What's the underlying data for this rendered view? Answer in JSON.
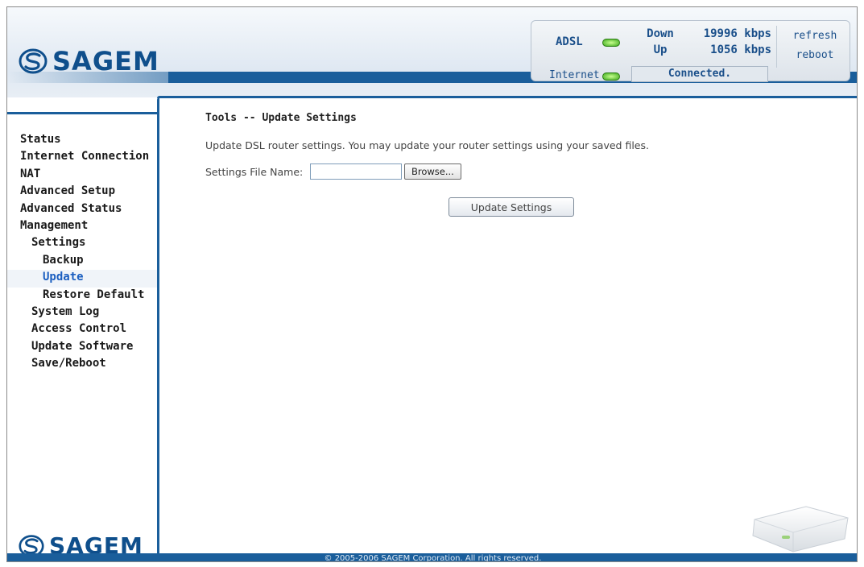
{
  "brand": {
    "name": "SAGEM"
  },
  "status_panel": {
    "adsl_label": "ADSL",
    "internet_label": "Internet",
    "down_label": "Down",
    "down_value": "19996 kbps",
    "up_label": "Up",
    "up_value": "1056 kbps",
    "connection_status": "Connected.",
    "refresh_label": "refresh",
    "reboot_label": "reboot",
    "led_color": "#3caa1c"
  },
  "sidebar": {
    "items": [
      {
        "label": "Status",
        "level": 1,
        "active": false
      },
      {
        "label": "Internet Connection",
        "level": 1,
        "active": false
      },
      {
        "label": "NAT",
        "level": 1,
        "active": false
      },
      {
        "label": "Advanced Setup",
        "level": 1,
        "active": false
      },
      {
        "label": "Advanced Status",
        "level": 1,
        "active": false
      },
      {
        "label": "Management",
        "level": 1,
        "active": false
      },
      {
        "label": "Settings",
        "level": 2,
        "active": false
      },
      {
        "label": "Backup",
        "level": 3,
        "active": false
      },
      {
        "label": "Update",
        "level": 3,
        "active": true
      },
      {
        "label": "Restore Default",
        "level": 3,
        "active": false
      },
      {
        "label": "System Log",
        "level": 2,
        "active": false
      },
      {
        "label": "Access Control",
        "level": 2,
        "active": false
      },
      {
        "label": "Update Software",
        "level": 2,
        "active": false
      },
      {
        "label": "Save/Reboot",
        "level": 2,
        "active": false
      }
    ]
  },
  "main": {
    "title": "Tools -- Update Settings",
    "description": "Update DSL router settings. You may update your router settings using your saved files.",
    "file_label": "Settings File Name:",
    "file_value": "",
    "browse_label": "Browse...",
    "update_button_label": "Update Settings"
  },
  "footer": {
    "copyright": "© 2005-2006 SAGEM Corporation. All rights reserved."
  },
  "colors": {
    "brand_blue": "#1a5e9b",
    "active_link": "#1a5ec0"
  }
}
